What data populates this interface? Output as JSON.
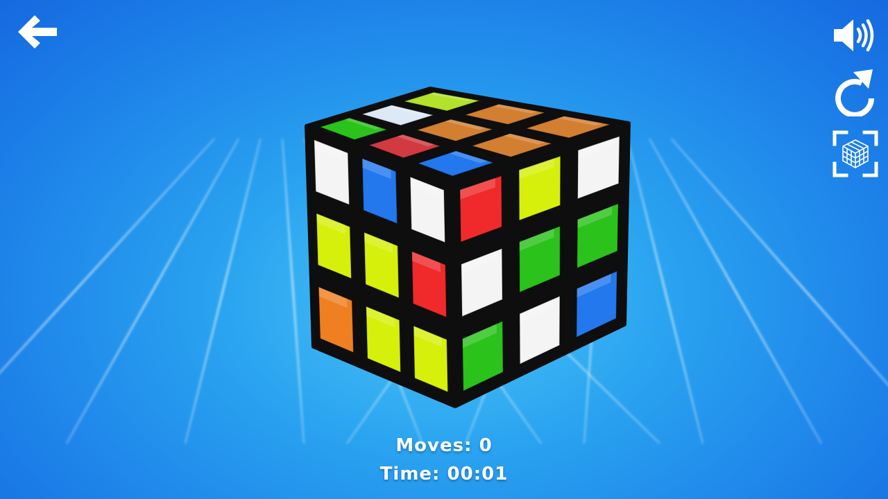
{
  "colors": {
    "background": "#2a9df0",
    "white": "#f4f4f4",
    "yellow": "#d6f00c",
    "green": "#2bc21c",
    "blue": "#2378ee",
    "red": "#f02a2a",
    "orange": "#f07f22",
    "top_lime": "#b3e22a",
    "top_white": "#dde9f6",
    "top_orange": "#d27f32",
    "top_red": "#d03a40"
  },
  "header": {
    "back_icon": "back-arrow-icon"
  },
  "toolbar": {
    "sound_icon": "speaker-volume-icon",
    "restart_icon": "restart-icon",
    "fullscreen_icon": "cube-frame-icon"
  },
  "cube": {
    "top": [
      [
        "top_lime",
        "top_orange",
        "top_orange"
      ],
      [
        "top_white",
        "top_orange",
        "top_orange"
      ],
      [
        "green",
        "top_red",
        "blue"
      ]
    ],
    "front": [
      [
        "white",
        "blue",
        "white"
      ],
      [
        "yellow",
        "yellow",
        "red"
      ],
      [
        "orange",
        "yellow",
        "yellow"
      ]
    ],
    "right": [
      [
        "red",
        "yellow",
        "white"
      ],
      [
        "white",
        "green",
        "green"
      ],
      [
        "green",
        "white",
        "blue"
      ]
    ]
  },
  "stats": {
    "moves_label": "Moves:",
    "moves_value": "0",
    "time_label": "Time:",
    "time_value": "00:01"
  }
}
